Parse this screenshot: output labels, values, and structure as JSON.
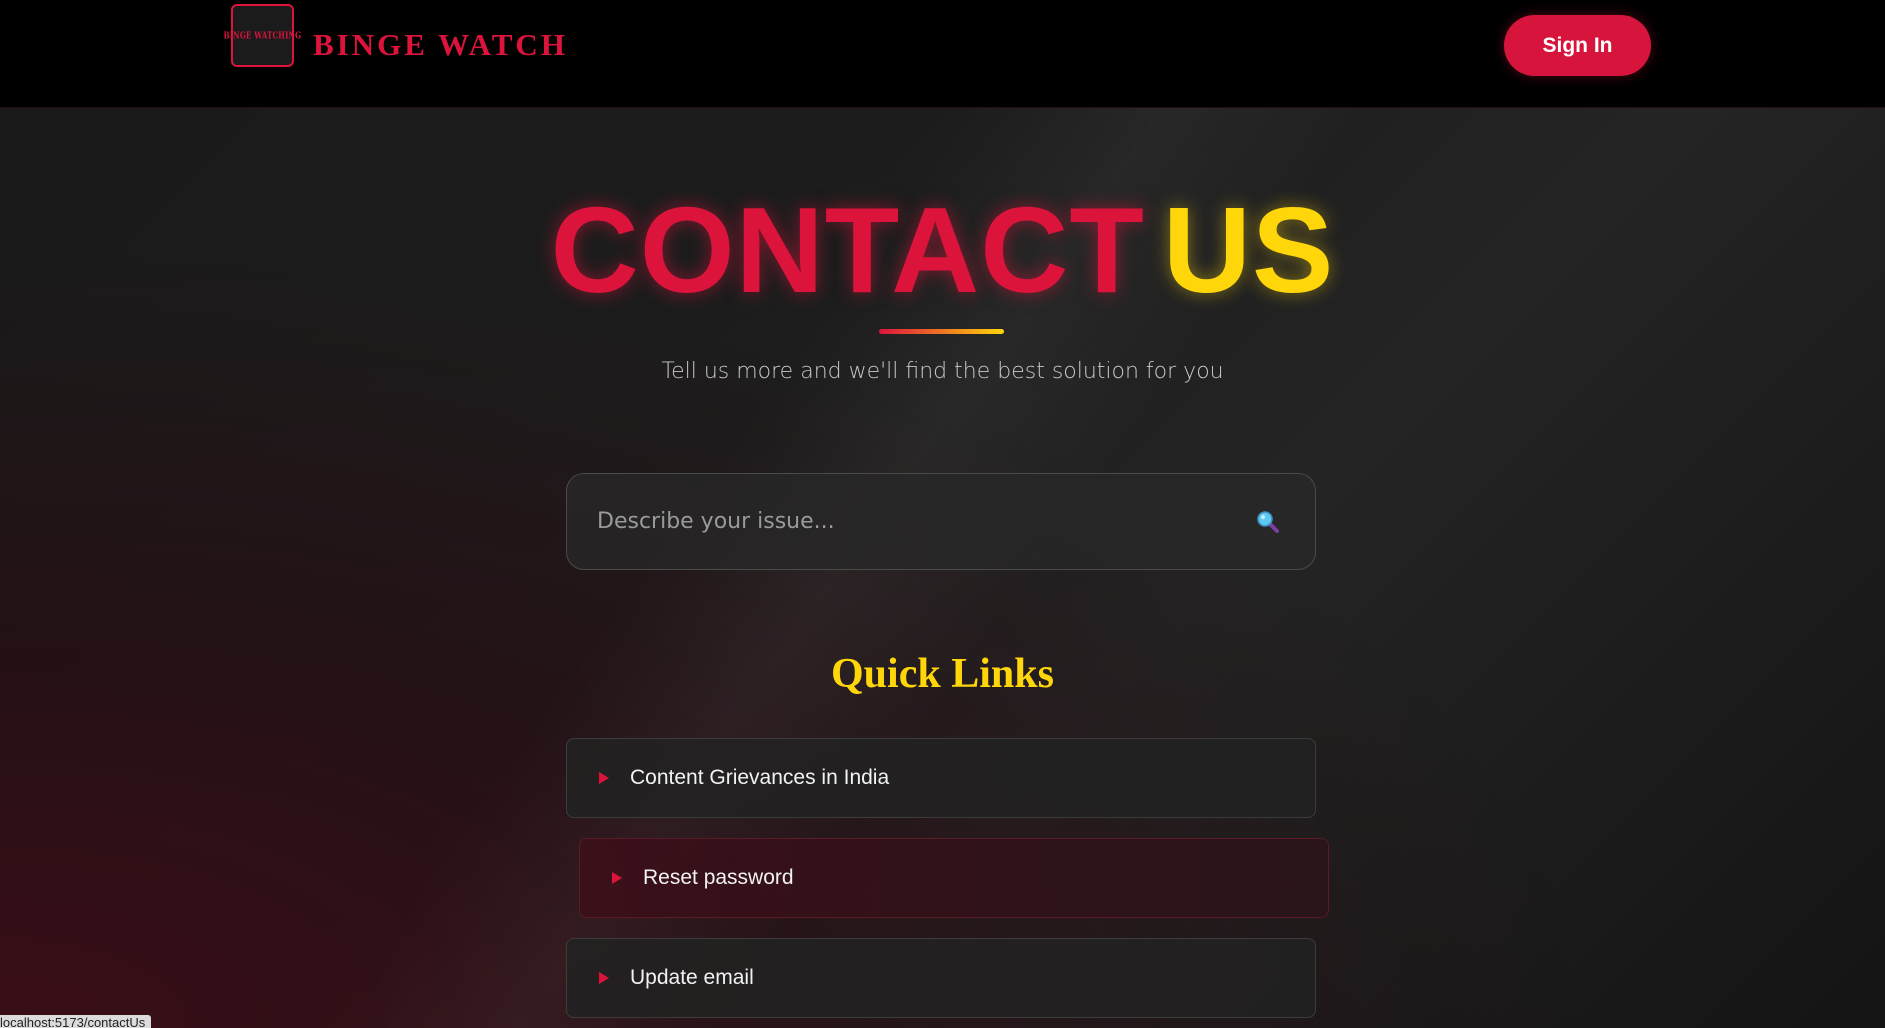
{
  "header": {
    "logo_text": "BINGE WATCHING",
    "brand_name": "BINGE WATCH",
    "signin_label": "Sign In"
  },
  "hero": {
    "title_part1": "CONTACT",
    "title_part2": "US",
    "subtitle": "Tell us more and we'll find the best solution for you"
  },
  "search": {
    "placeholder": "Describe your issue...",
    "value": ""
  },
  "quick_links": {
    "title": "Quick Links",
    "items": [
      {
        "label": "Content Grievances in India"
      },
      {
        "label": "Reset password"
      },
      {
        "label": "Update email"
      }
    ]
  },
  "status_bar": {
    "url": "localhost:5173/contactUs"
  },
  "colors": {
    "accent_red": "#dc143c",
    "accent_yellow": "#ffd60a",
    "background": "#1a1a1a"
  }
}
